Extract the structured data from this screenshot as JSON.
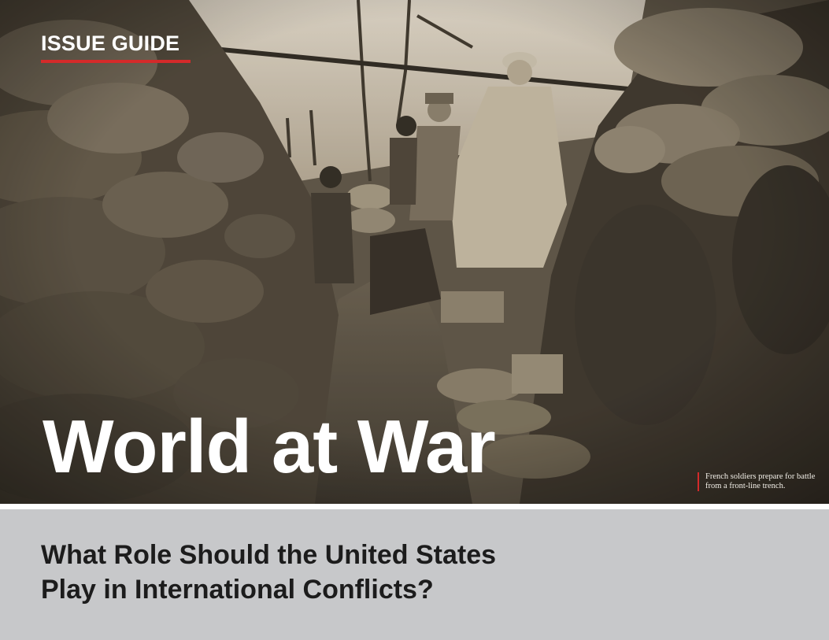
{
  "header": {
    "kicker": "ISSUE GUIDE"
  },
  "hero": {
    "title": "World at War",
    "caption_line1": "French soldiers prepare for battle",
    "caption_line2": "from a front-line trench."
  },
  "band": {
    "subtitle_line1": "What Role Should the United States",
    "subtitle_line2": "Play in International Conflicts?"
  },
  "colors": {
    "accent": "#d42a2a",
    "band": "#c7c8ca",
    "text_dark": "#1c1c1c",
    "text_light": "#ffffff"
  }
}
